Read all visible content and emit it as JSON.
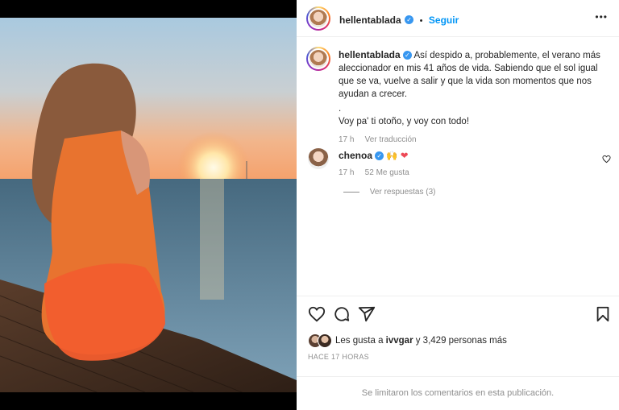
{
  "post": {
    "username": "hellentablada",
    "follow_label": "Seguir",
    "more_label": "•••",
    "caption_text": "Así despido a, probablemente, el verano más aleccionador en mis 41 años de vida. Sabiendo que el sol igual que se va, vuelve a salir y que la vida son momentos que nos ayudan a crecer.",
    "caption_dot": ".",
    "caption_line2": "Voy pa' ti otoño, y voy con todo!",
    "caption_time": "17 h",
    "translate_label": "Ver traducción"
  },
  "comment": {
    "username": "chenoa",
    "text": "🙌 ❤",
    "time": "17 h",
    "likes": "52 Me gusta",
    "replies_label": "Ver respuestas (3)"
  },
  "likes": {
    "text_prefix": "Les gusta a ",
    "user": "ivvgar",
    "text_suffix": " y 3,429 personas más"
  },
  "timestamp": "HACE 17 HORAS",
  "comments_limited": "Se limitaron los comentarios en esta publicación.",
  "icons": [
    "heart-icon",
    "comment-icon",
    "share-icon",
    "bookmark-icon",
    "more-icon",
    "verified-icon"
  ],
  "colors": {
    "accent": "#0095f6",
    "verified": "#3897f0",
    "heart": "#ed4956"
  }
}
